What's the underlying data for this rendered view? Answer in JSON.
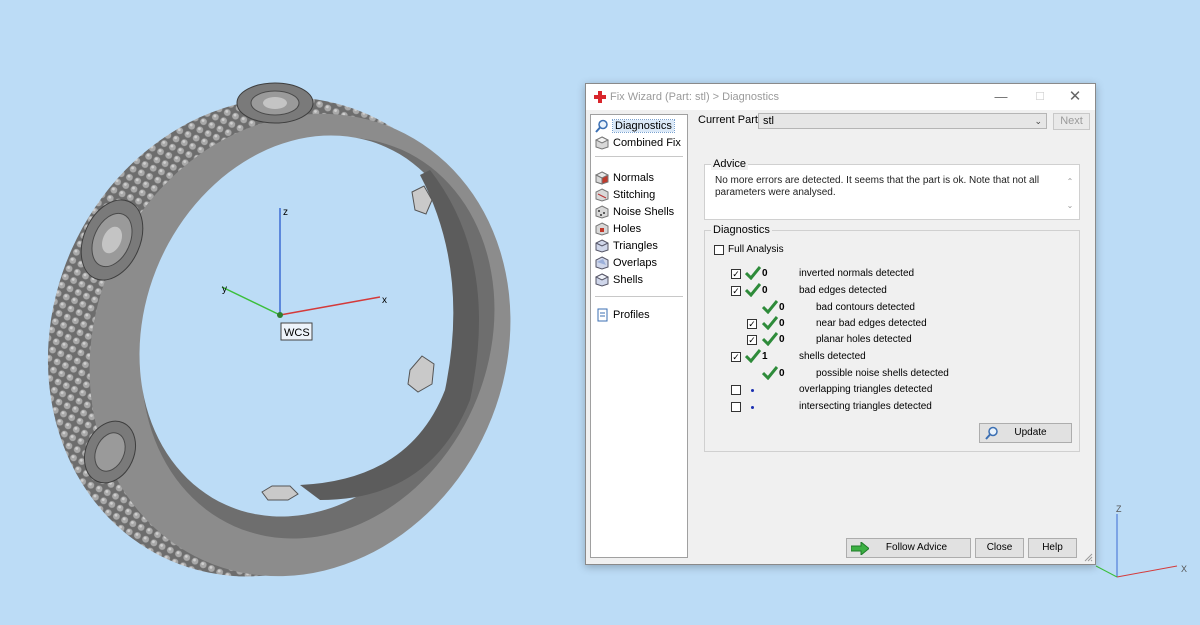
{
  "viewport": {
    "axis_z": "z",
    "axis_y": "y",
    "axis_x": "x",
    "wcs_label": "WCS",
    "mini_axis_z": "Z",
    "mini_axis_x": "X"
  },
  "dialog": {
    "title": "Fix Wizard (Part: stl) > Diagnostics",
    "sidebar": {
      "items": [
        {
          "label": "Diagnostics",
          "icon": "magnifier-icon",
          "selected": true
        },
        {
          "label": "Combined Fix",
          "icon": "cube-icon"
        },
        {
          "label": "Normals",
          "icon": "normals-cube-icon"
        },
        {
          "label": "Stitching",
          "icon": "stitching-icon"
        },
        {
          "label": "Noise Shells",
          "icon": "noise-shells-icon"
        },
        {
          "label": "Holes",
          "icon": "holes-icon"
        },
        {
          "label": "Triangles",
          "icon": "triangles-icon"
        },
        {
          "label": "Overlaps",
          "icon": "overlaps-icon"
        },
        {
          "label": "Shells",
          "icon": "shells-icon"
        },
        {
          "label": "Profiles",
          "icon": "document-icon"
        }
      ]
    },
    "current_part_label": "Current Part:",
    "current_part_value": "stl",
    "next_label": "Next",
    "advice": {
      "title": "Advice",
      "text": "No more errors are detected. It seems that the part is ok. Note that not all parameters were analysed."
    },
    "diagnostics": {
      "title": "Diagnostics",
      "full_analysis_label": "Full Analysis",
      "full_analysis_checked": false,
      "rows": [
        {
          "checkbox": true,
          "checked": true,
          "status": "ok",
          "count": "0",
          "label": "inverted normals detected",
          "indent": 0
        },
        {
          "checkbox": true,
          "checked": true,
          "status": "ok",
          "count": "0",
          "label": "bad edges detected",
          "indent": 0
        },
        {
          "checkbox": false,
          "checked": false,
          "status": "ok",
          "count": "0",
          "label": "bad contours detected",
          "indent": 1
        },
        {
          "checkbox": true,
          "checked": true,
          "status": "ok",
          "count": "0",
          "label": "near bad edges detected",
          "indent": 1
        },
        {
          "checkbox": true,
          "checked": true,
          "status": "ok",
          "count": "0",
          "label": "planar holes detected",
          "indent": 1
        },
        {
          "checkbox": true,
          "checked": true,
          "status": "ok",
          "count": "1",
          "label": "shells detected",
          "indent": 0
        },
        {
          "checkbox": false,
          "checked": false,
          "status": "ok",
          "count": "0",
          "label": "possible noise shells detected",
          "indent": 1
        },
        {
          "checkbox": true,
          "checked": false,
          "status": "pending",
          "count": "",
          "label": "overlapping triangles detected",
          "indent": 0
        },
        {
          "checkbox": true,
          "checked": false,
          "status": "pending",
          "count": "",
          "label": "intersecting triangles detected",
          "indent": 0
        }
      ],
      "update_label": "Update"
    },
    "buttons": {
      "follow_advice": "Follow Advice",
      "close": "Close",
      "help": "Help"
    },
    "colors": {
      "check_green": "#2e8b3a",
      "follow_arrow": "#3cb043",
      "title_icon": "#d9262c"
    }
  }
}
